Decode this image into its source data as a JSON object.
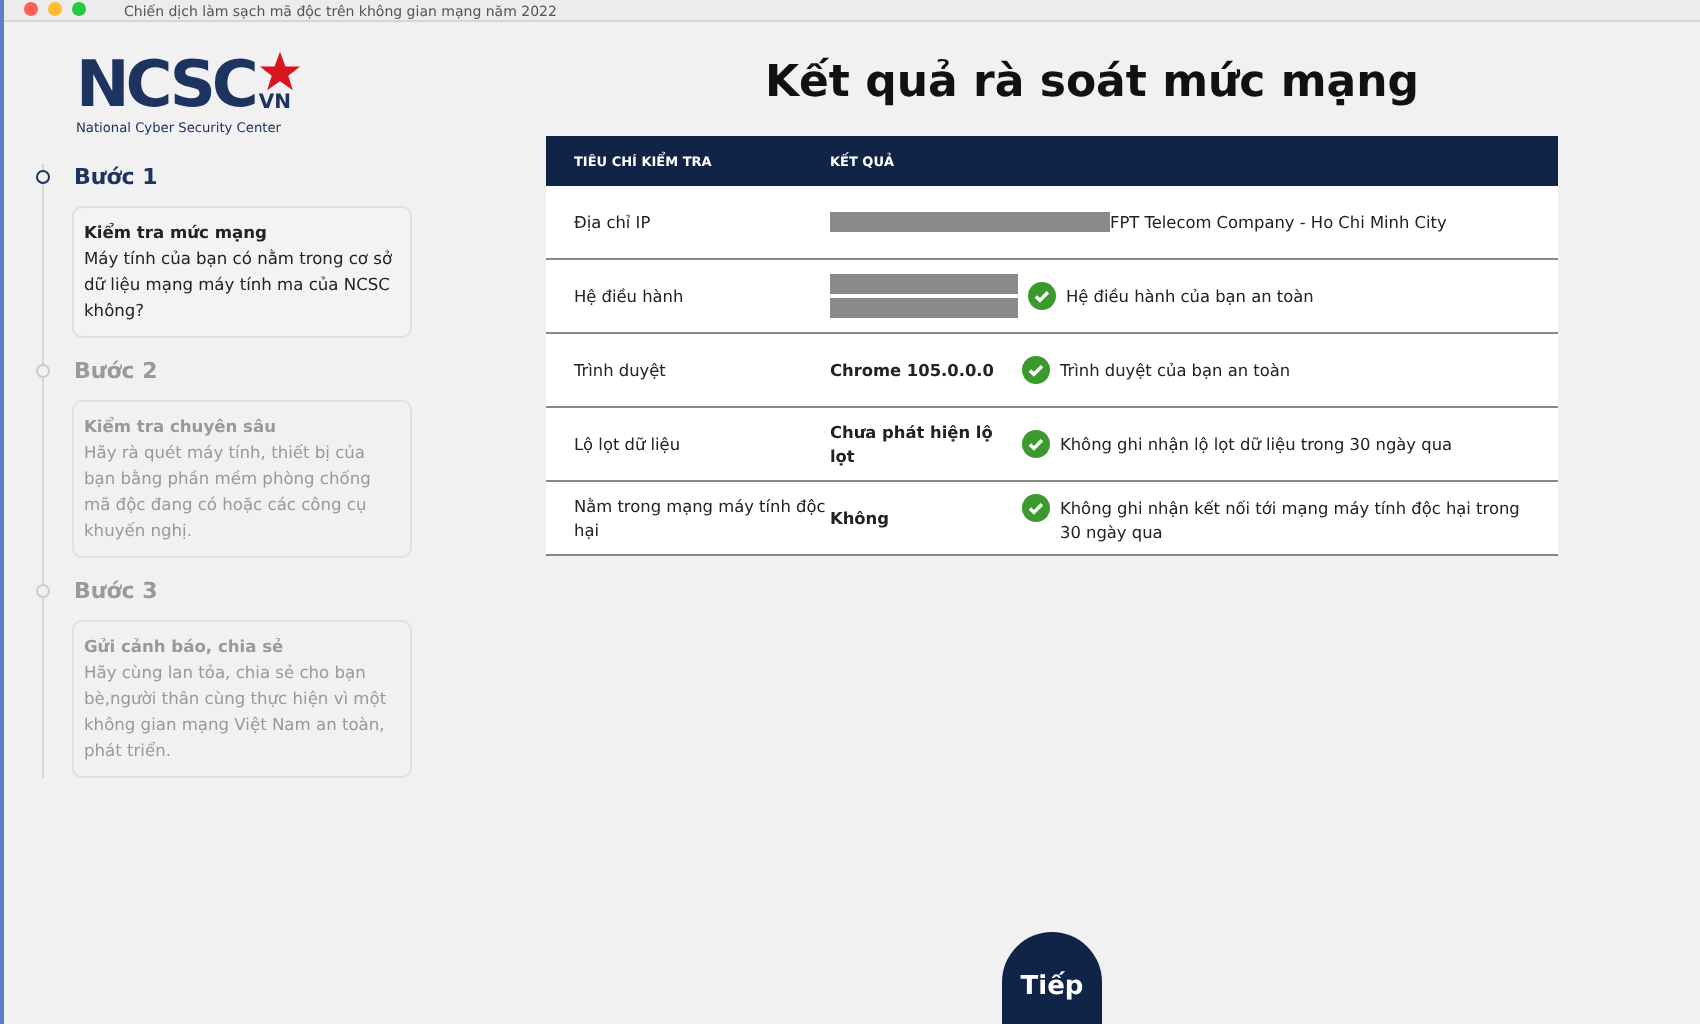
{
  "window": {
    "title": "Chiến dịch làm sạch mã độc trên không gian mạng năm 2022"
  },
  "logo": {
    "mark": "NCSC",
    "country": "VN",
    "subtitle": "National Cyber Security Center"
  },
  "steps": [
    {
      "label": "Bước 1",
      "selected": true,
      "title": "Kiểm tra mức mạng",
      "text": "Máy tính của bạn có nằm trong cơ sở dữ liệu mạng máy tính ma của NCSC không?"
    },
    {
      "label": "Bước 2",
      "selected": false,
      "title": "Kiểm tra chuyên sâu",
      "text": "Hãy rà quét máy tính, thiết bị của bạn bằng phần mềm phòng chống mã độc đang có hoặc các công cụ khuyến nghị."
    },
    {
      "label": "Bước 3",
      "selected": false,
      "title": "Gửi cảnh báo, chia sẻ",
      "text": "Hãy cùng lan tỏa, chia sẻ cho bạn bè,người thân cùng thực hiện vì một không gian mạng Việt Nam an toàn, phát triển."
    }
  ],
  "heading": "Kết quả rà soát mức mạng",
  "table": {
    "columns": [
      "TIÊU CHÍ KIỂM TRA",
      "KẾT QUẢ"
    ],
    "rows": [
      {
        "kind": "info",
        "label": "Địa chỉ IP",
        "redacted": true,
        "detail": "FPT Telecom Company - Ho Chi Minh City"
      },
      {
        "kind": "check",
        "label": "Hệ điều hành",
        "redacted": true,
        "status": "Hệ điều hành của bạn an toàn"
      },
      {
        "kind": "check",
        "label": "Trình duyệt",
        "redacted": false,
        "value": "Chrome 105.0.0.0",
        "status": "Trình duyệt của bạn an toàn"
      },
      {
        "kind": "check",
        "label": "Lộ lọt dữ liệu",
        "redacted": false,
        "value": "Chưa phát hiện lộ lọt",
        "status": "Không ghi nhận lộ lọt dữ liệu trong 30 ngày qua"
      },
      {
        "kind": "check",
        "label": "Nằm trong mạng máy tính độc hại",
        "redacted": false,
        "value": "Không",
        "status": "Không ghi nhận kết nối tới mạng máy tính độc hại trong 30 ngày qua"
      }
    ]
  },
  "next_button": "Tiếp"
}
